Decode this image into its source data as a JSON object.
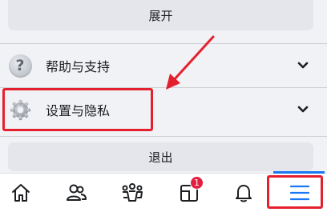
{
  "expand_button": {
    "label": "展开"
  },
  "menu": {
    "items": [
      {
        "label": "帮助与支持",
        "icon": "help-icon"
      },
      {
        "label": "设置与隐私",
        "icon": "gear-icon"
      }
    ]
  },
  "logout_button": {
    "label": "退出"
  },
  "tabbar": {
    "notifications_badge": "1",
    "tabs": [
      "home-icon",
      "friends-icon",
      "groups-icon",
      "feed-icon",
      "bell-icon",
      "menu-icon"
    ],
    "active_color": "#1877f2"
  },
  "annotations": {
    "highlight_color": "#e5202e"
  }
}
